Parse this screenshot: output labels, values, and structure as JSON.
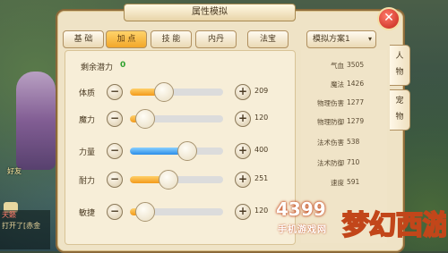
{
  "panel": {
    "title": "属性模拟",
    "close_label": "✕"
  },
  "tabs": [
    {
      "label": "基 础",
      "active": false
    },
    {
      "label": "加 点",
      "active": true
    },
    {
      "label": "技 能",
      "active": false
    },
    {
      "label": "内丹",
      "active": false
    },
    {
      "label": "法宝",
      "active": false
    }
  ],
  "potential": {
    "label": "剩余潜力",
    "value": "0"
  },
  "attributes": [
    {
      "label": "体质",
      "value": "209",
      "level": 0.3,
      "color": "orange"
    },
    {
      "label": "魔力",
      "value": "120",
      "level": 0.1,
      "color": "orange"
    },
    {
      "label": "力量",
      "value": "400",
      "level": 0.55,
      "color": "blue"
    },
    {
      "label": "耐力",
      "value": "251",
      "level": 0.35,
      "color": "orange"
    },
    {
      "label": "敏捷",
      "value": "120",
      "level": 0.1,
      "color": "orange"
    }
  ],
  "controls": {
    "minus": "−",
    "plus": "+"
  },
  "scheme": {
    "label": "模拟方案1",
    "chevron": "▾"
  },
  "stats": [
    {
      "label": "气血",
      "value": "3505"
    },
    {
      "label": "魔法",
      "value": "1426"
    },
    {
      "label": "物理伤害",
      "value": "1277"
    },
    {
      "label": "物理防御",
      "value": "1279"
    },
    {
      "label": "法术伤害",
      "value": "538"
    },
    {
      "label": "法术防御",
      "value": "710"
    },
    {
      "label": "速度",
      "value": "591"
    }
  ],
  "side_tabs": [
    {
      "label": [
        "人",
        "物"
      ]
    },
    {
      "label": [
        "宠",
        "物"
      ]
    }
  ],
  "background": {
    "friend": "好友",
    "chat": [
      "天籁",
      "打开了[赤金"
    ]
  },
  "watermark": {
    "brand": "4399",
    "sub": "手机游戏网",
    "logo": "梦幻西游"
  },
  "colors": {
    "accent": "#f2a72a",
    "close": "#c22418",
    "potential": "#2da02d"
  }
}
